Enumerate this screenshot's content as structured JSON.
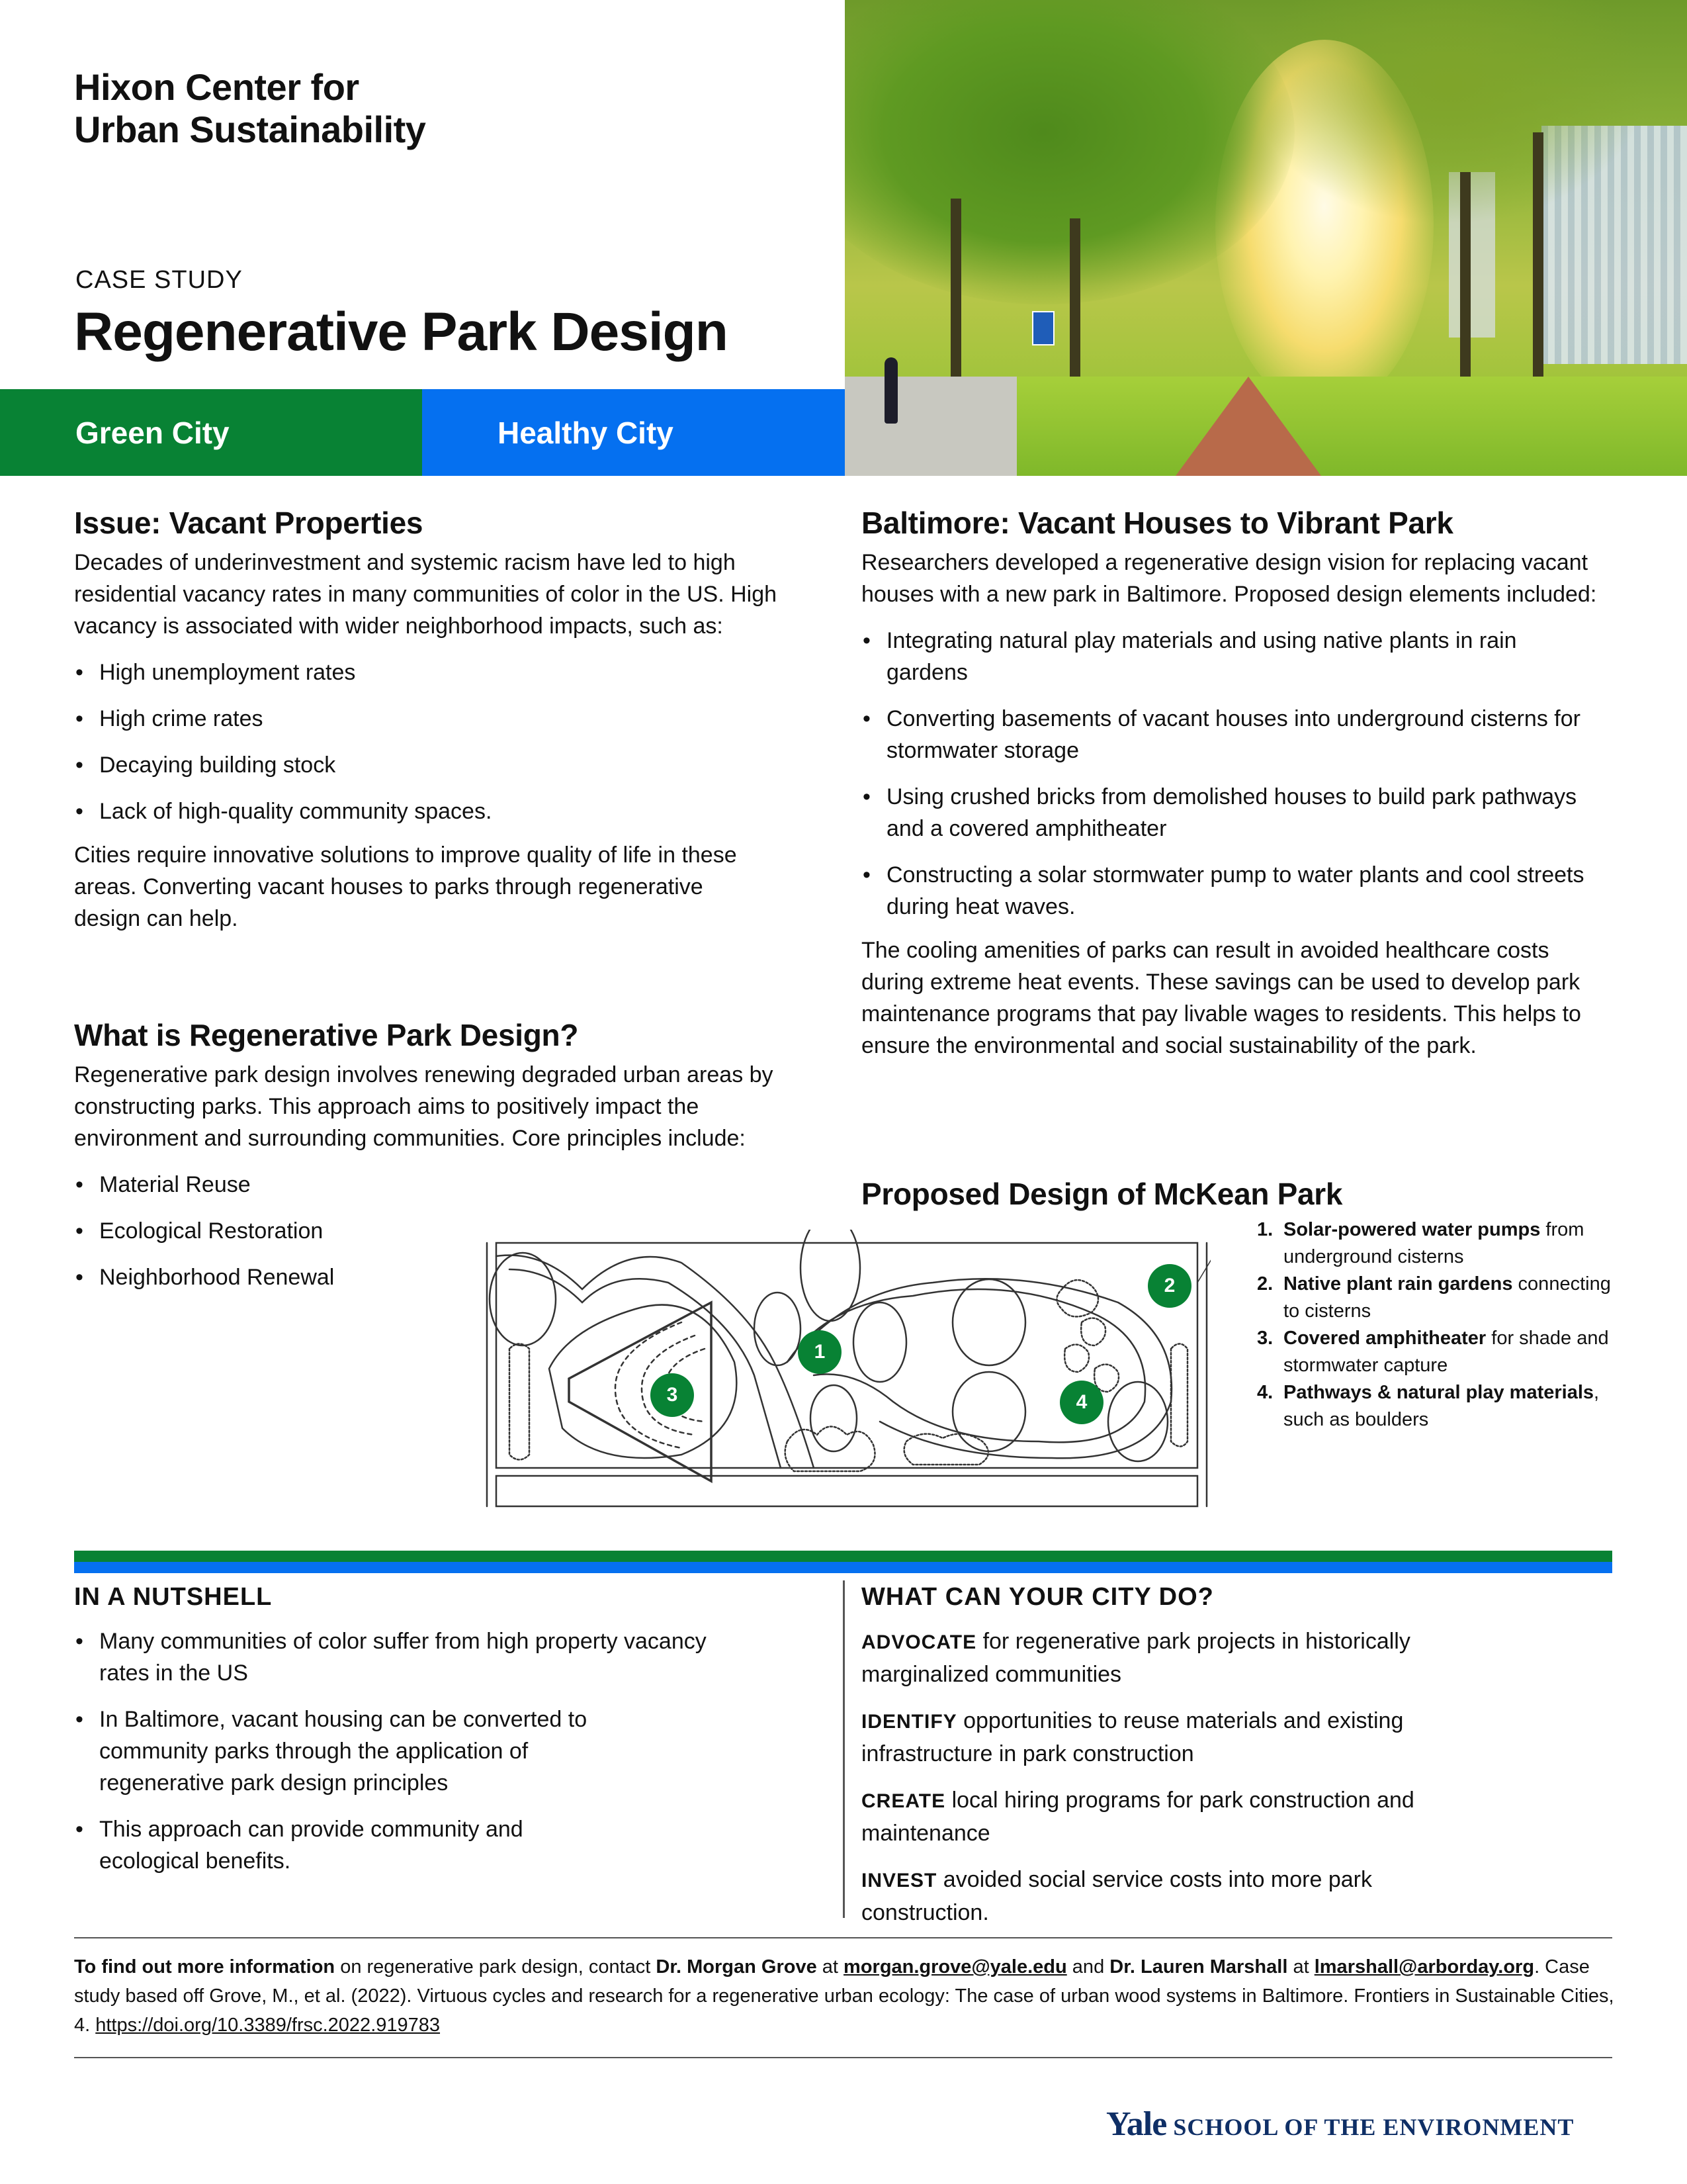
{
  "header": {
    "org_line1": "Hixon Center for",
    "org_line2": "Urban Sustainability",
    "case_label": "CASE STUDY",
    "title": "Regenerative Park Design",
    "tags": [
      {
        "label": "Green City",
        "color": "#088234"
      },
      {
        "label": "Healthy City",
        "color": "#0570F0"
      }
    ],
    "hero_image": "park-path-with-trees-and-sunlight"
  },
  "issue": {
    "heading": "Issue: Vacant Properties",
    "intro": "Decades of underinvestment and systemic racism have led to high residential vacancy rates in many communities of color in the US. High vacancy is associated with wider neighborhood impacts, such as:",
    "bullets": [
      "High unemployment rates",
      "High crime rates",
      "Decaying building stock",
      "Lack of high-quality community spaces."
    ],
    "closing": "Cities require innovative solutions to improve quality of life in these areas. Converting vacant houses to parks through regenerative design can help."
  },
  "what_is": {
    "heading": "What is Regenerative Park Design?",
    "body": "Regenerative park design involves renewing degraded urban areas by constructing parks. This approach aims to positively impact the environment and surrounding communities. Core principles include:",
    "bullets": [
      "Material Reuse",
      "Ecological Restoration",
      "Neighborhood Renewal"
    ]
  },
  "baltimore": {
    "heading": "Baltimore: Vacant Houses to Vibrant Park",
    "intro": "Researchers developed a regenerative design vision for replacing vacant houses with a new park in Baltimore. Proposed design elements included:",
    "bullets": [
      "Integrating natural play materials and using native plants in rain gardens",
      "Converting basements of vacant houses into underground cisterns for stormwater storage",
      "Using crushed bricks from demolished houses to build park pathways and a covered amphitheater",
      "Constructing a solar stormwater pump to water plants and cool streets during heat waves."
    ],
    "closing": "The cooling amenities of parks can result in avoided healthcare costs during extreme heat events. These savings can be used to develop park maintenance programs that pay livable wages to residents. This helps to ensure the environmental and social sustainability of the park."
  },
  "design": {
    "heading": "Proposed Design of McKean Park",
    "markers": [
      "1",
      "2",
      "3",
      "4"
    ],
    "marker_color": "#088234",
    "legend": [
      {
        "num": "1.",
        "bold": "Solar-powered water pumps",
        "rest": " from underground cisterns"
      },
      {
        "num": "2.",
        "bold": "Native plant rain gardens",
        "rest": " connecting to cisterns"
      },
      {
        "num": "3.",
        "bold": "Covered amphitheater",
        "rest": " for shade and stormwater capture"
      },
      {
        "num": "4.",
        "bold": "Pathways & natural play materials",
        "rest": ", such as boulders"
      }
    ]
  },
  "nutshell": {
    "heading": "IN A NUTSHELL",
    "bullets": [
      "Many communities of color suffer from high property vacancy rates in the US",
      "In Baltimore, vacant housing can be converted to community parks through the application of regenerative park design principles",
      "This approach can provide community and ecological benefits."
    ]
  },
  "city_do": {
    "heading": "WHAT CAN YOUR CITY DO?",
    "actions": [
      {
        "verb": "ADVOCATE",
        "text": " for regenerative park projects in historically marginalized communities"
      },
      {
        "verb": "IDENTIFY",
        "text": " opportunities to reuse materials and existing infrastructure in park construction"
      },
      {
        "verb": "CREATE",
        "text": " local hiring programs for park construction and maintenance"
      },
      {
        "verb": "INVEST",
        "text": " avoided social service costs into more park construction."
      }
    ]
  },
  "footer": {
    "lead_bold": "To find out more information",
    "lead_rest": " on regenerative park design, contact ",
    "contact1_name": "Dr. Morgan Grove",
    "at1": " at ",
    "contact1_email": "morgan.grove@yale.edu",
    "and": " and ",
    "contact2_name": "Dr. Lauren Marshall",
    "at2": " at ",
    "contact2_email": "lmarshall@arborday.org",
    "citation": ". Case study based off Grove, M., et al. (2022). Virtuous cycles and research for a regenerative urban ecology: The case of urban wood systems in Baltimore. Frontiers in Sustainable Cities, 4. ",
    "doi": "https://doi.org/10.3389/frsc.2022.919783"
  },
  "logo": {
    "yale": "Yale",
    "school": "SCHOOL OF THE ENVIRONMENT"
  }
}
